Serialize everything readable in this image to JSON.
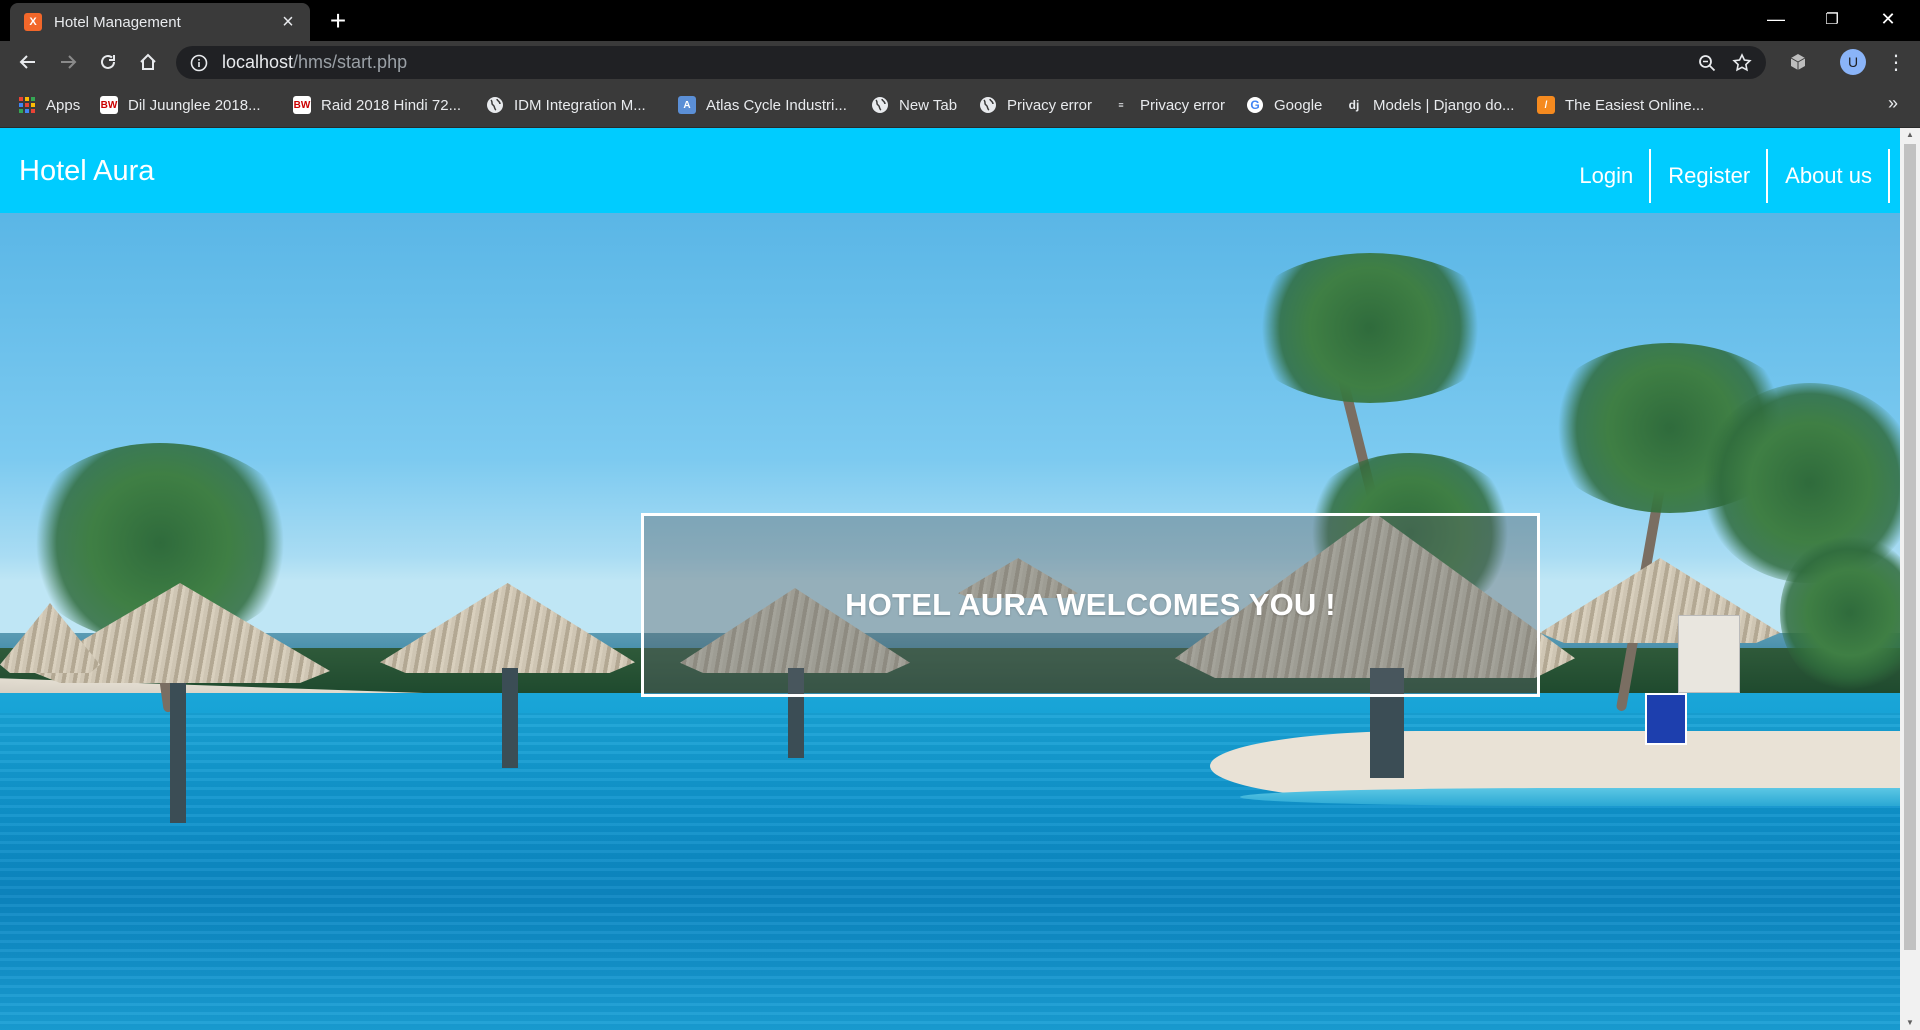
{
  "browser": {
    "tab_title": "Hotel Management",
    "tab_favicon_text": "X",
    "url_host": "localhost",
    "url_path": "/hms/start.php",
    "profile_initial": "U",
    "window_controls": {
      "minimize": "—",
      "restore": "❐",
      "close": "✕"
    }
  },
  "bookmarks": [
    {
      "label": "Apps",
      "icon": "apps-grid-icon"
    },
    {
      "label": "Dil Juunglee 2018...",
      "icon": "site-badge-icon"
    },
    {
      "label": "Raid 2018 Hindi 72...",
      "icon": "site-badge-icon"
    },
    {
      "label": "IDM Integration M...",
      "icon": "globe-icon"
    },
    {
      "label": "Atlas Cycle Industri...",
      "icon": "site-icon"
    },
    {
      "label": "New Tab",
      "icon": "globe-icon"
    },
    {
      "label": "Privacy error",
      "icon": "globe-icon"
    },
    {
      "label": "Privacy error",
      "icon": "site-icon"
    },
    {
      "label": "Google",
      "icon": "google-icon"
    },
    {
      "label": "Models | Django do...",
      "icon": "django-icon"
    },
    {
      "label": "The Easiest Online...",
      "icon": "site-icon"
    }
  ],
  "bookmarks_more": "»",
  "site": {
    "brand": "Hotel Aura",
    "nav": [
      "Login",
      "Register",
      "About us"
    ],
    "welcome": "HOTEL AURA WELCOMES YOU !"
  },
  "colors": {
    "header": "#00ccff",
    "chrome_dark": "#3a3a3a"
  }
}
